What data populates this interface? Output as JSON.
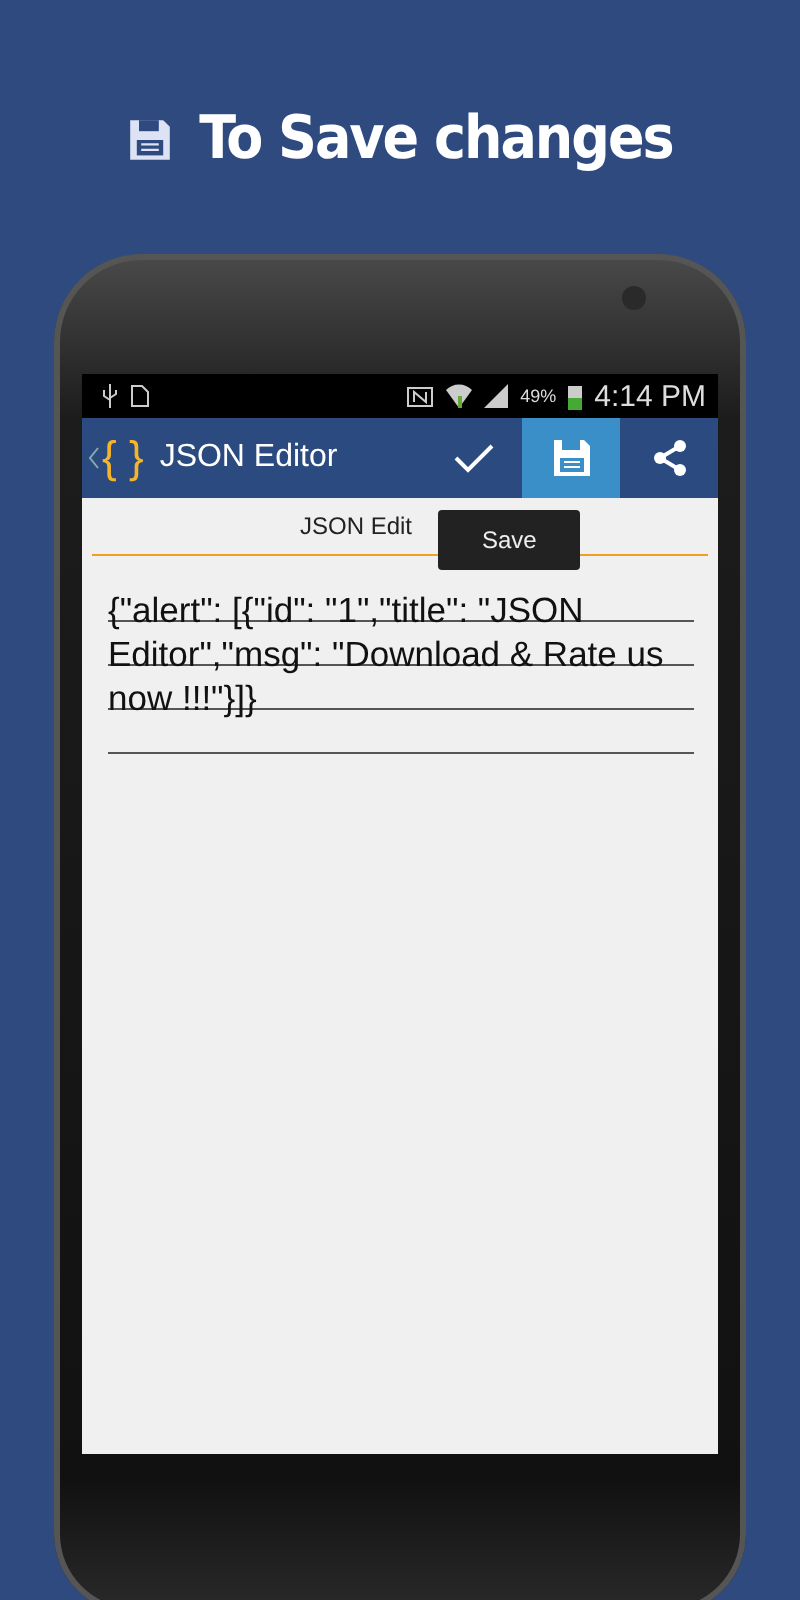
{
  "banner": {
    "title": "To Save changes"
  },
  "status_bar": {
    "battery": "49%",
    "time": "4:14 PM"
  },
  "app_bar": {
    "logo": "{ }",
    "title": "JSON Editor",
    "actions": [
      {
        "kind": "check",
        "selected": false
      },
      {
        "kind": "save",
        "selected": true
      },
      {
        "kind": "share",
        "selected": false
      }
    ]
  },
  "subtitle": "JSON Edit",
  "tooltip": "Save",
  "editor": {
    "value": "{\"alert\": [{\"id\": \"1\",\"title\": \"JSON Editor\",\"msg\": \"Download & Rate us now !!!\"}]}"
  }
}
